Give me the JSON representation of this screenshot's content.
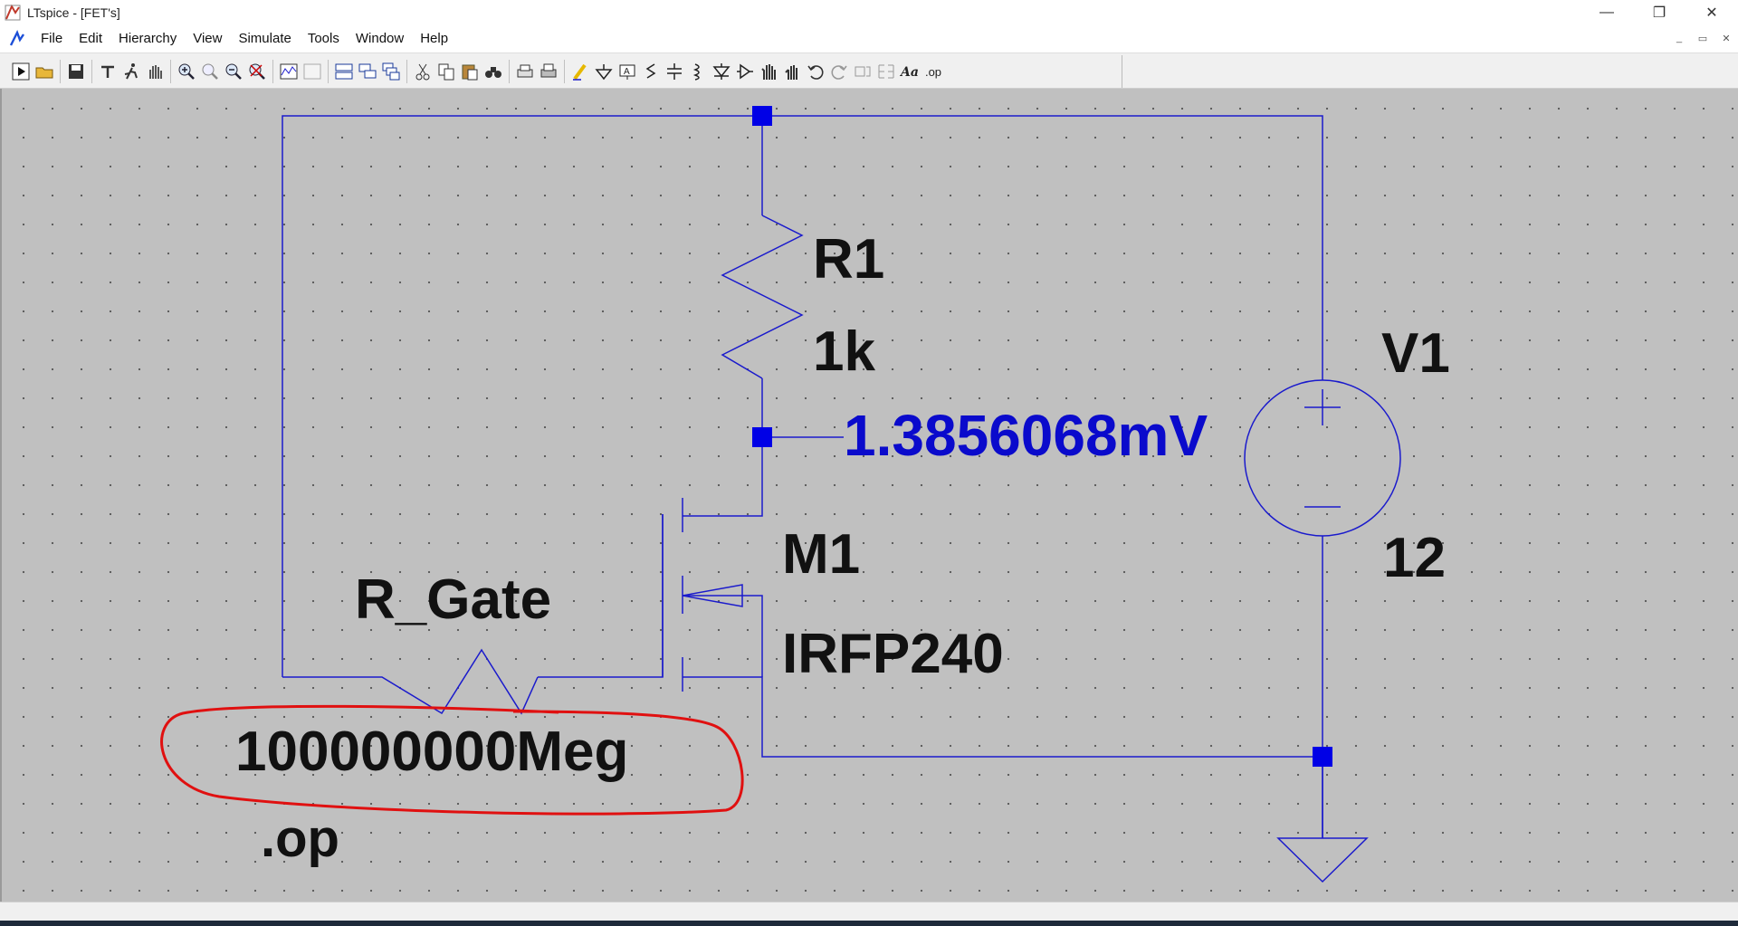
{
  "window": {
    "title": "LTspice - [FET's]",
    "controls": {
      "minimize": "—",
      "restore": "❐",
      "close": "✕"
    }
  },
  "menu": {
    "items": [
      "File",
      "Edit",
      "Hierarchy",
      "View",
      "Simulate",
      "Tools",
      "Window",
      "Help"
    ],
    "mdi_controls": [
      "_",
      "▭",
      "✕"
    ]
  },
  "toolbar": {
    "icons": [
      "run-icon",
      "open-icon",
      "save-icon",
      "control-panel-icon",
      "halt-icon",
      "pan-icon",
      "zoom-in-icon",
      "zoom-area-icon",
      "zoom-out-icon",
      "zoom-fit-icon",
      "waveform-icon",
      "waveform-off-icon",
      "tile-horizontal-icon",
      "tile-vertical-icon",
      "cascade-icon",
      "cut-icon",
      "copy-icon",
      "paste-icon",
      "find-icon",
      "print-setup-icon",
      "print-icon",
      "draw-wire-icon",
      "ground-icon",
      "label-net-icon",
      "resistor-icon",
      "capacitor-icon",
      "inductor-icon",
      "diode-icon",
      "component-icon",
      "move-icon",
      "drag-icon",
      "undo-icon",
      "redo-icon",
      "rotate-icon",
      "mirror-icon",
      "text-icon",
      "spice-directive-icon"
    ],
    "directive_label": ".op"
  },
  "schematic": {
    "components": {
      "r1": {
        "name": "R1",
        "value": "1k"
      },
      "v1": {
        "name": "V1",
        "value": "12"
      },
      "m1": {
        "name": "M1",
        "value": "IRFP240"
      },
      "r_gate": {
        "name": "R_Gate",
        "value": "100000000Meg"
      }
    },
    "node_voltage": "1.3856068mV",
    "directive": ".op",
    "colors": {
      "wire": "#1a1acc",
      "node": "#0000e6",
      "voltage_label": "#0a0acc",
      "annotation": "#e01010",
      "background": "#c0c0c0"
    }
  }
}
